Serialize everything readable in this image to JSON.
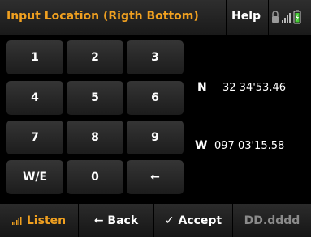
{
  "header": {
    "title": "Input Location (Rigth Bottom)",
    "help_label": "Help",
    "status_icons": [
      "lock-icon",
      "signal-icon",
      "battery-icon"
    ]
  },
  "keypad": {
    "keys": [
      {
        "label": "1",
        "name": "key-1"
      },
      {
        "label": "2",
        "name": "key-2"
      },
      {
        "label": "3",
        "name": "key-3"
      },
      {
        "label": "4",
        "name": "key-4"
      },
      {
        "label": "5",
        "name": "key-5"
      },
      {
        "label": "6",
        "name": "key-6"
      },
      {
        "label": "7",
        "name": "key-7"
      },
      {
        "label": "8",
        "name": "key-8"
      },
      {
        "label": "9",
        "name": "key-9"
      },
      {
        "label": "W/E",
        "name": "key-west-east"
      },
      {
        "label": "0",
        "name": "key-0"
      },
      {
        "label": "←",
        "name": "key-backspace"
      }
    ]
  },
  "coordinates": {
    "latitude": {
      "direction": "N",
      "value": "32 34'53.46"
    },
    "longitude": {
      "direction": "W",
      "value": "097 03'15.58"
    }
  },
  "footer": {
    "listen_label": "Listen",
    "back_label": "← Back",
    "accept_label": "✓ Accept",
    "format_label": "DD.dddd"
  },
  "colors": {
    "accent": "#f0a020",
    "disabled": "#8a8a8a",
    "battery": "#44cc33"
  }
}
